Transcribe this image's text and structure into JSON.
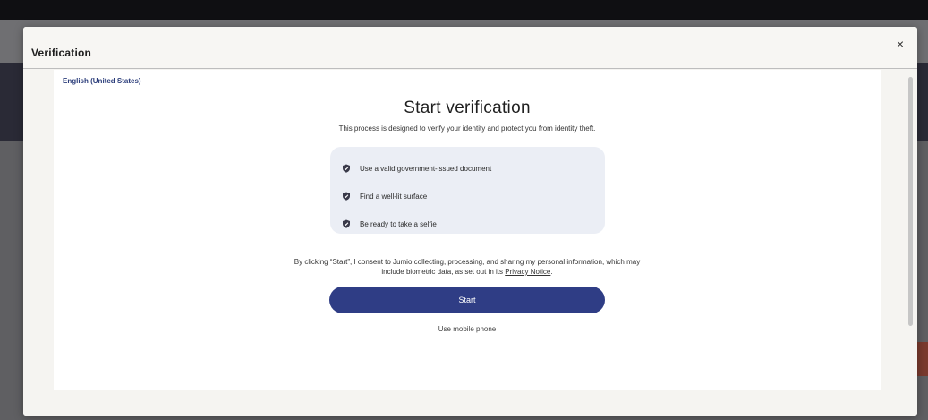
{
  "modal": {
    "title": "Verification",
    "close_label": "×"
  },
  "language": "English (United States)",
  "heading": "Start verification",
  "subheading": "This process is designed to verify your identity and protect you from identity theft.",
  "tips": [
    {
      "icon": "shield-check-icon",
      "label": "Use a valid government-issued document"
    },
    {
      "icon": "shield-check-icon",
      "label": "Find a well-lit surface"
    },
    {
      "icon": "shield-check-icon",
      "label": "Be ready to take a selfie"
    }
  ],
  "consent": {
    "line1": "By clicking “Start”, I consent to Jumio collecting, processing, and sharing my personal information, which may",
    "line2_prefix": "include biometric data, as set out in its ",
    "privacy_link": "Privacy Notice",
    "line2_suffix": "."
  },
  "start_label": "Start",
  "mobile_label": "Use mobile phone",
  "colors": {
    "primary": "#2f3d85",
    "tips_bg": "#ebeef5",
    "language_link": "#2a3c7a"
  }
}
